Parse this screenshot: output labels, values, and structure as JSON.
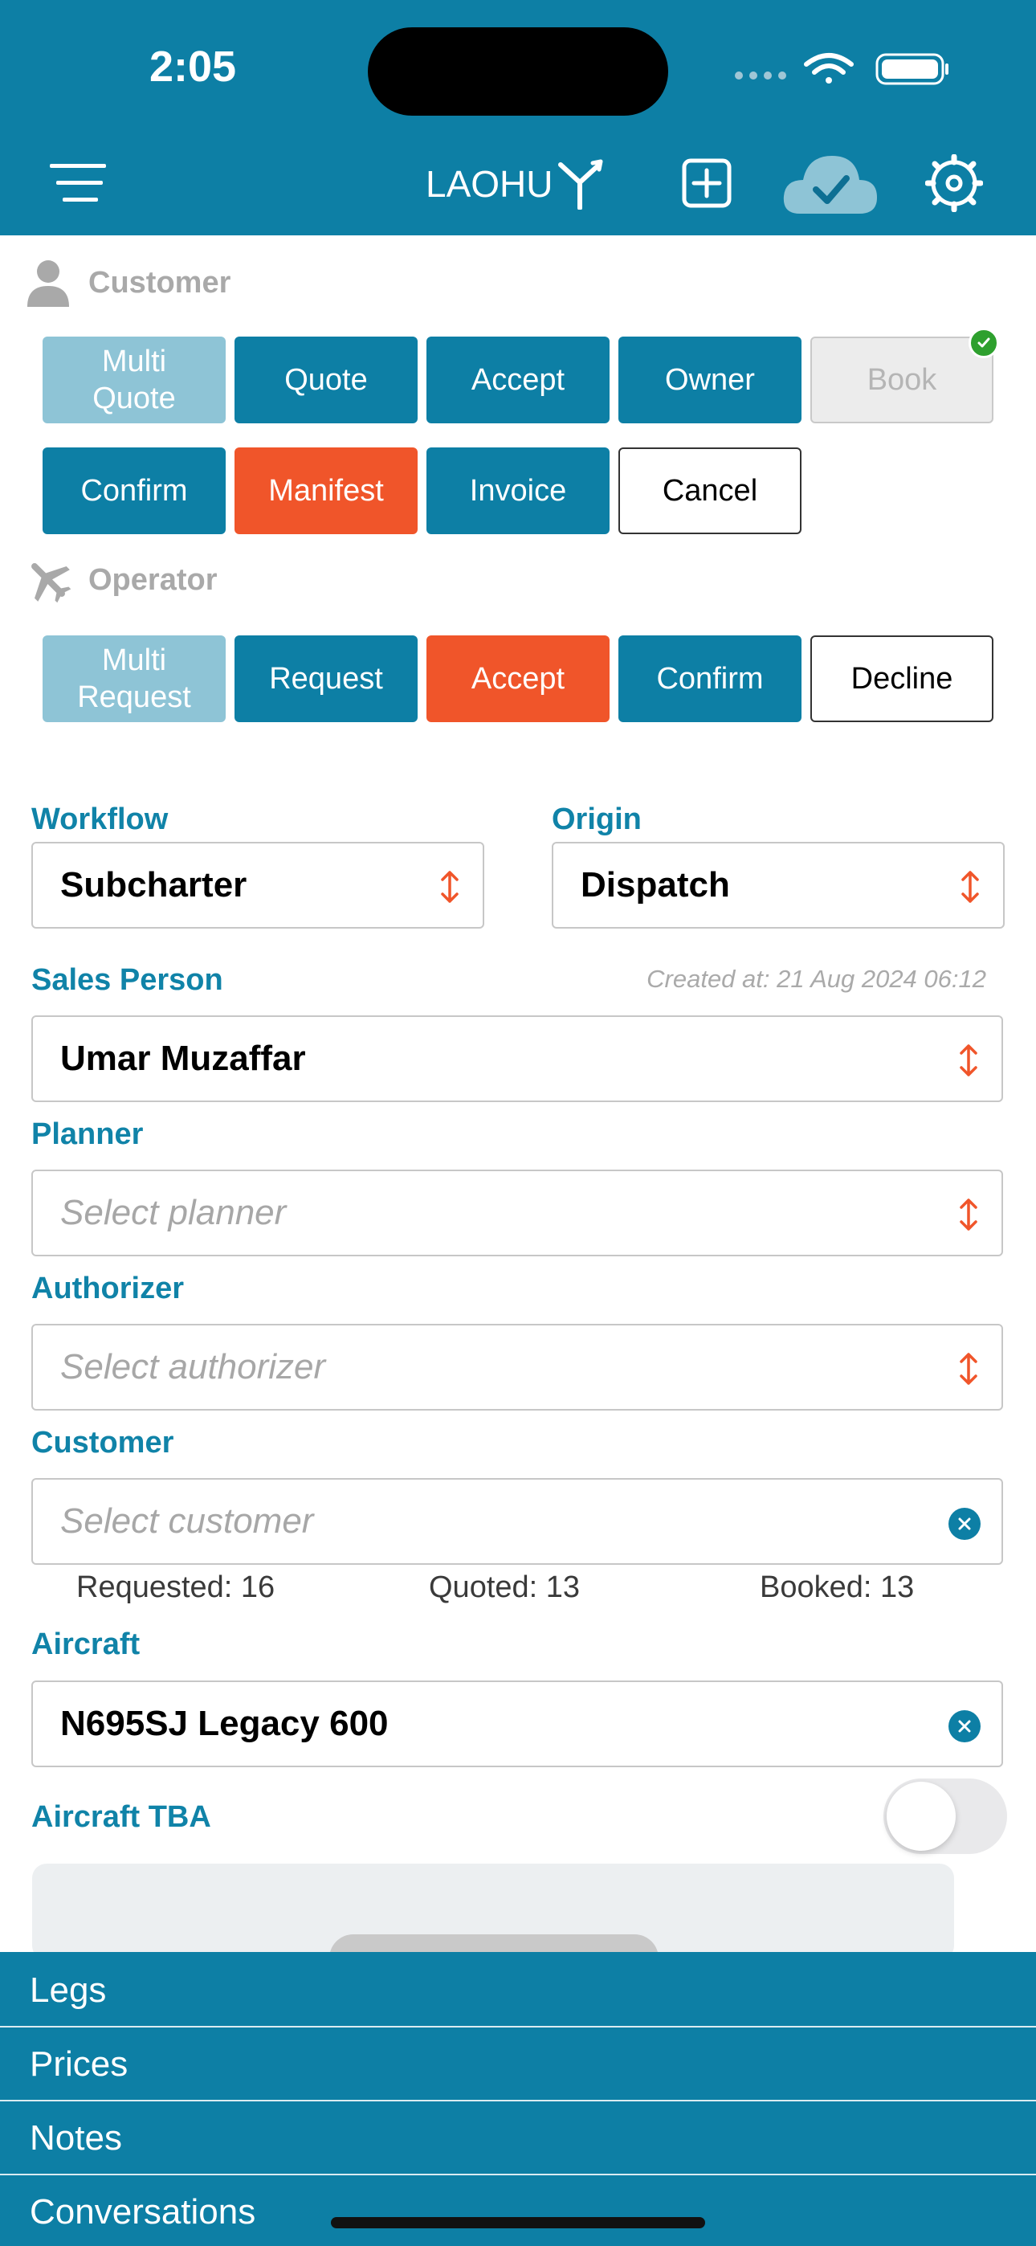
{
  "status_bar": {
    "time": "2:05"
  },
  "header": {
    "logo_text": "LAOHU"
  },
  "customer_section": {
    "title": "Customer",
    "row1": [
      {
        "label": "Multi Quote",
        "style": "light"
      },
      {
        "label": "Quote",
        "style": "teal"
      },
      {
        "label": "Accept",
        "style": "teal"
      },
      {
        "label": "Owner",
        "style": "teal"
      },
      {
        "label": "Book",
        "style": "disabled",
        "completed": true
      }
    ],
    "row2": [
      {
        "label": "Confirm",
        "style": "teal"
      },
      {
        "label": "Manifest",
        "style": "orange"
      },
      {
        "label": "Invoice",
        "style": "teal"
      },
      {
        "label": "Cancel",
        "style": "outline"
      }
    ]
  },
  "operator_section": {
    "title": "Operator",
    "buttons": [
      {
        "label": "Multi Request",
        "style": "light"
      },
      {
        "label": "Request",
        "style": "teal"
      },
      {
        "label": "Accept",
        "style": "orange"
      },
      {
        "label": "Confirm",
        "style": "teal"
      },
      {
        "label": "Decline",
        "style": "outline"
      }
    ]
  },
  "form": {
    "workflow": {
      "label": "Workflow",
      "value": "Subcharter"
    },
    "origin": {
      "label": "Origin",
      "value": "Dispatch"
    },
    "sales_person": {
      "label": "Sales Person",
      "value": "Umar Muzaffar"
    },
    "created_at": "Created at: 21 Aug 2024 06:12",
    "planner": {
      "label": "Planner",
      "placeholder": "Select planner"
    },
    "authorizer": {
      "label": "Authorizer",
      "placeholder": "Select authorizer"
    },
    "customer": {
      "label": "Customer",
      "placeholder": "Select customer"
    },
    "stats": {
      "requested": "Requested: 16",
      "quoted": "Quoted: 13",
      "booked": "Booked: 13"
    },
    "aircraft": {
      "label": "Aircraft",
      "value": "N695SJ Legacy 600"
    },
    "aircraft_tba": {
      "label": "Aircraft TBA",
      "enabled": false
    }
  },
  "bottom_sections": [
    "Legs",
    "Prices",
    "Notes",
    "Conversations"
  ],
  "colors": {
    "primary": "#0d7fa5",
    "accent": "#f0552a",
    "light": "#8ec4d6",
    "label": "#1083a8"
  }
}
